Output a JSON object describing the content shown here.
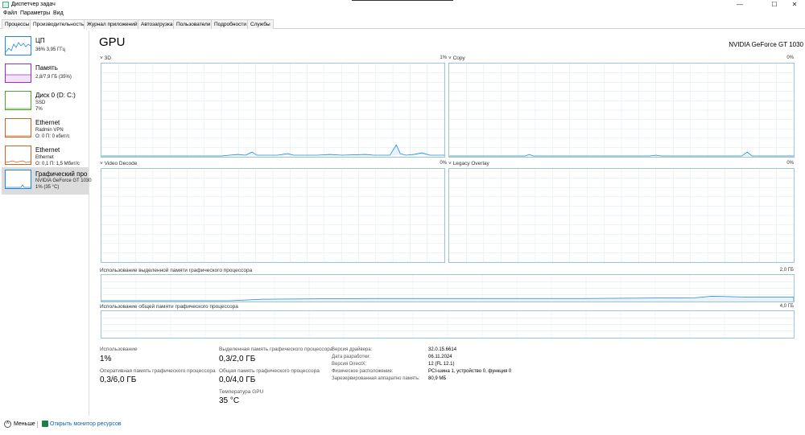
{
  "window": {
    "title": "Диспетчер задач",
    "controls": {
      "minimize": "—",
      "maximize": "☐",
      "close": "✕"
    }
  },
  "menu": [
    "Файл",
    "Параметры",
    "Вид"
  ],
  "tabs": [
    {
      "label": "Процессы",
      "active": false
    },
    {
      "label": "Производительность",
      "active": true
    },
    {
      "label": "Журнал приложений",
      "active": false
    },
    {
      "label": "Автозагрузка",
      "active": false
    },
    {
      "label": "Пользователи",
      "active": false
    },
    {
      "label": "Подробности",
      "active": false
    },
    {
      "label": "Службы",
      "active": false
    }
  ],
  "sidebar": [
    {
      "name": "ЦП",
      "line1": "36% 3,95 ГГц",
      "line2": "",
      "color": "#1f8ad6",
      "selected": false
    },
    {
      "name": "Память",
      "line1": "2,8/7,9 ГБ (35%)",
      "line2": "",
      "color": "#9b30c9",
      "selected": false
    },
    {
      "name": "Диск 0 (D: C:)",
      "line1": "SSD",
      "line2": "7%",
      "color": "#4da62e",
      "selected": false
    },
    {
      "name": "Ethernet",
      "line1": "Radmin VPN",
      "line2": "О: 0 П: 0 кбит/с",
      "color": "#c8661f",
      "selected": false
    },
    {
      "name": "Ethernet",
      "line1": "Ethernet",
      "line2": "О: 0,1 П: 1,5 Мбит/с",
      "color": "#c8661f",
      "selected": false
    },
    {
      "name": "Графический про",
      "line1": "NVIDIA GeForce GT 1030",
      "line2": "1% (35 °C)",
      "color": "#1f8ad6",
      "selected": true
    }
  ],
  "header": {
    "title": "GPU",
    "model": "NVIDIA GeForce GT 1030"
  },
  "engines": [
    {
      "label": "3D",
      "percent": "1%"
    },
    {
      "label": "Copy",
      "percent": "0%"
    },
    {
      "label": "Video Decode",
      "percent": "0%"
    },
    {
      "label": "Legacy Overlay",
      "percent": "0%"
    }
  ],
  "memory_charts": [
    {
      "label": "Использование выделенной памяти графического процессора",
      "max": "2,0 ГБ"
    },
    {
      "label": "Использование общей памяти графического процессора",
      "max": "4,0 ГБ"
    }
  ],
  "stats": {
    "usage_label": "Использование",
    "usage_value": "1%",
    "dedicated_label": "Выделенная память графического процессора",
    "dedicated_value": "0,3/2,0 ГБ",
    "ram_label": "Оперативная память графического процессора",
    "ram_value": "0,3/6,0 ГБ",
    "shared_label": "Общая память графического процессора",
    "shared_value": "0,0/4,0 ГБ",
    "temp_label": "Температура GPU",
    "temp_value": "35 °C"
  },
  "info": [
    {
      "key": "Версия драйвера:",
      "value": "32.0.15.6614"
    },
    {
      "key": "Дата разработки:",
      "value": "06.11.2024"
    },
    {
      "key": "Версия DirectX:",
      "value": "12 (FL 12.1)"
    },
    {
      "key": "Физическое расположение:",
      "value": "PCI-шина 1, устройство 0, функция 0"
    },
    {
      "key": "Зарезервированная аппаратно память:",
      "value": "80,9 МБ"
    }
  ],
  "footer": {
    "less": "Меньше",
    "link": "Открыть монитор ресурсов"
  },
  "colors": {
    "grid": "#d9e8f1",
    "border": "#9fc3d8",
    "line": "#1f8ad6",
    "fill": "#e8f2fa"
  }
}
